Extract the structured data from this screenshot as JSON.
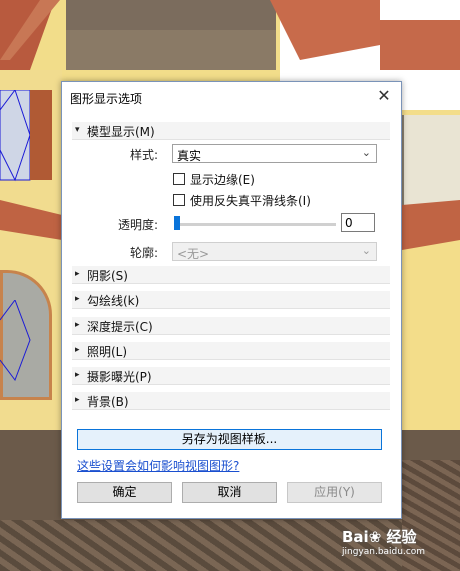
{
  "dialog": {
    "title": "图形显示选项",
    "close_glyph": "✕"
  },
  "model_display": {
    "section_label": "模型显示(M)",
    "style_label": "样式:",
    "style_value": "真实",
    "show_edges_label": "显示边缘(E)",
    "show_edges_checked": false,
    "antialias_label": "使用反失真平滑线条(I)",
    "antialias_checked": false,
    "transparency_label": "透明度:",
    "transparency_value": "0",
    "silhouette_label": "轮廓:",
    "silhouette_value": "<无>"
  },
  "sections": [
    {
      "label": "阴影(S)"
    },
    {
      "label": "勾绘线(k)"
    },
    {
      "label": "深度提示(C)"
    },
    {
      "label": "照明(L)"
    },
    {
      "label": "摄影曝光(P)"
    },
    {
      "label": "背景(B)"
    }
  ],
  "buttons": {
    "save_template": "另存为视图样板...",
    "ok": "确定",
    "cancel": "取消",
    "apply": "应用(Y)"
  },
  "help_link": "这些设置会如何影响视图图形?",
  "icons": {
    "expanded": "▾",
    "collapsed": "▸",
    "dropdown": "⌄"
  },
  "watermark": {
    "text": "Bai❀ 经验",
    "sub": "jingyan.baidu.com"
  }
}
